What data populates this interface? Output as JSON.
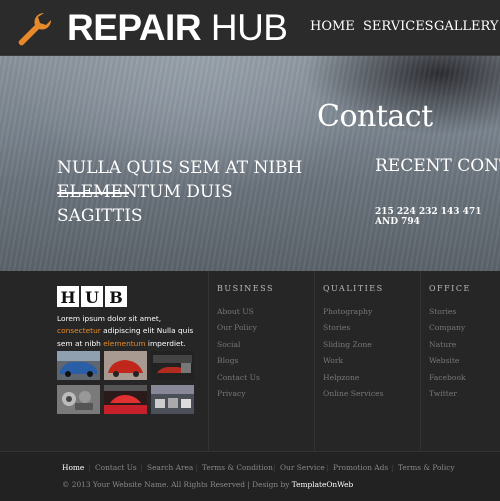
{
  "header": {
    "logo_icon": "wrench-icon",
    "logo_word1": "REPAIR",
    "logo_word2": "HUB",
    "nav": [
      "HOME",
      "SERVICES",
      "GALLERY"
    ]
  },
  "hero": {
    "title": "Contact",
    "heading": "NULLA QUIS SEM AT NIBH ELEMENTUM DUIS SAGITTIS",
    "recent": "RECENT CONTA",
    "phone": "215 224 232 143 471 AND 794"
  },
  "about": {
    "logo_letters": [
      "H",
      "U",
      "B"
    ],
    "text_pre": "Lorem ipsum dolor sit amet, ",
    "link1": "consectetur",
    "text_mid": " adipiscing elit Nulla quis sem at nibh ",
    "link2": "elementum",
    "text_post": " imperdiet."
  },
  "columns": [
    {
      "title": "BUSINESS",
      "items": [
        "About US",
        "Our Policy",
        "Social",
        "Blogs",
        "Contact Us",
        "Privacy"
      ]
    },
    {
      "title": "QUALITIES",
      "items": [
        "Photography",
        "Stories",
        "Sliding Zone",
        "Work",
        "Helpzone",
        "Online Services"
      ]
    },
    {
      "title": "OFFICE",
      "items": [
        "Stories",
        "Company",
        "Nature",
        "Website",
        "Facebook",
        "Twitter"
      ]
    }
  ],
  "bottom_nav": [
    "Home",
    "Contact Us",
    "Search Area",
    "Terms & Condition",
    "Our Service",
    "Promotion Ads",
    "Terms & Policy"
  ],
  "copyright": {
    "text": "© 2013 Your Website Name. All Rights Reserved | Design by ",
    "designer": "TemplateOnWeb"
  },
  "colors": {
    "accent": "#e88a2a",
    "header_bg": "#2b2b2b",
    "footer_bg": "#262626"
  }
}
